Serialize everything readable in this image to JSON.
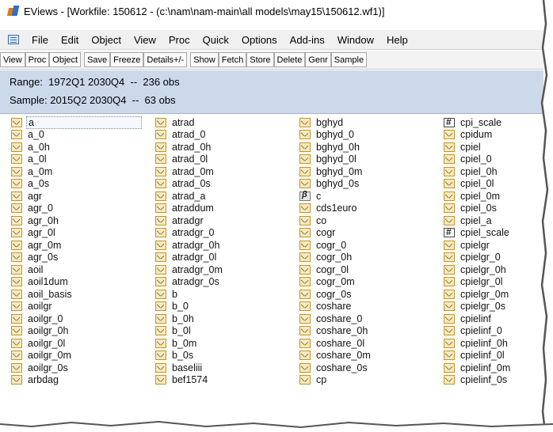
{
  "window": {
    "title": "EViews - [Workfile: 150612 - (c:\\nam\\nam-main\\all models\\may15\\150612.wf1)]"
  },
  "menubar": {
    "items": [
      "File",
      "Edit",
      "Object",
      "View",
      "Proc",
      "Quick",
      "Options",
      "Add-ins",
      "Window",
      "Help"
    ]
  },
  "toolbar": {
    "group1": [
      "View",
      "Proc",
      "Object"
    ],
    "group2": [
      "Save",
      "Freeze",
      "Details+/-"
    ],
    "group3": [
      "Show",
      "Fetch",
      "Store",
      "Delete",
      "Genr",
      "Sample"
    ]
  },
  "info": {
    "range": "Range:  1972Q1 2030Q4  --  236 obs",
    "sample": "Sample: 2015Q2 2030Q4  --  63 obs"
  },
  "objects": {
    "columns": [
      [
        {
          "name": "a",
          "icon": "series-icon",
          "selected": true
        },
        {
          "name": "a_0",
          "icon": "series-icon"
        },
        {
          "name": "a_0h",
          "icon": "series-icon"
        },
        {
          "name": "a_0l",
          "icon": "series-icon"
        },
        {
          "name": "a_0m",
          "icon": "series-icon"
        },
        {
          "name": "a_0s",
          "icon": "series-icon"
        },
        {
          "name": "agr",
          "icon": "series-icon"
        },
        {
          "name": "agr_0",
          "icon": "series-icon"
        },
        {
          "name": "agr_0h",
          "icon": "series-icon"
        },
        {
          "name": "agr_0l",
          "icon": "series-icon"
        },
        {
          "name": "agr_0m",
          "icon": "series-icon"
        },
        {
          "name": "agr_0s",
          "icon": "series-icon"
        },
        {
          "name": "aoil",
          "icon": "series-icon"
        },
        {
          "name": "aoil1dum",
          "icon": "series-icon"
        },
        {
          "name": "aoil_basis",
          "icon": "series-icon"
        },
        {
          "name": "aoilgr",
          "icon": "series-icon"
        },
        {
          "name": "aoilgr_0",
          "icon": "series-icon"
        },
        {
          "name": "aoilgr_0h",
          "icon": "series-icon"
        },
        {
          "name": "aoilgr_0l",
          "icon": "series-icon"
        },
        {
          "name": "aoilgr_0m",
          "icon": "series-icon"
        },
        {
          "name": "aoilgr_0s",
          "icon": "series-icon"
        },
        {
          "name": "arbdag",
          "icon": "series-icon"
        }
      ],
      [
        {
          "name": "atrad",
          "icon": "series-icon"
        },
        {
          "name": "atrad_0",
          "icon": "series-icon"
        },
        {
          "name": "atrad_0h",
          "icon": "series-icon"
        },
        {
          "name": "atrad_0l",
          "icon": "series-icon"
        },
        {
          "name": "atrad_0m",
          "icon": "series-icon"
        },
        {
          "name": "atrad_0s",
          "icon": "series-icon"
        },
        {
          "name": "atrad_a",
          "icon": "series-icon"
        },
        {
          "name": "atraddum",
          "icon": "series-icon"
        },
        {
          "name": "atradgr",
          "icon": "series-icon"
        },
        {
          "name": "atradgr_0",
          "icon": "series-icon"
        },
        {
          "name": "atradgr_0h",
          "icon": "series-icon"
        },
        {
          "name": "atradgr_0l",
          "icon": "series-icon"
        },
        {
          "name": "atradgr_0m",
          "icon": "series-icon"
        },
        {
          "name": "atradgr_0s",
          "icon": "series-icon"
        },
        {
          "name": "b",
          "icon": "series-icon"
        },
        {
          "name": "b_0",
          "icon": "series-icon"
        },
        {
          "name": "b_0h",
          "icon": "series-icon"
        },
        {
          "name": "b_0l",
          "icon": "series-icon"
        },
        {
          "name": "b_0m",
          "icon": "series-icon"
        },
        {
          "name": "b_0s",
          "icon": "series-icon"
        },
        {
          "name": "baseliii",
          "icon": "series-icon"
        },
        {
          "name": "bef1574",
          "icon": "series-icon"
        }
      ],
      [
        {
          "name": "bghyd",
          "icon": "series-icon"
        },
        {
          "name": "bghyd_0",
          "icon": "series-icon"
        },
        {
          "name": "bghyd_0h",
          "icon": "series-icon"
        },
        {
          "name": "bghyd_0l",
          "icon": "series-icon"
        },
        {
          "name": "bghyd_0m",
          "icon": "series-icon"
        },
        {
          "name": "bghyd_0s",
          "icon": "series-icon"
        },
        {
          "name": "c",
          "icon": "coef-icon"
        },
        {
          "name": "cds1euro",
          "icon": "series-icon"
        },
        {
          "name": "co",
          "icon": "series-icon"
        },
        {
          "name": "cogr",
          "icon": "series-icon"
        },
        {
          "name": "cogr_0",
          "icon": "series-icon"
        },
        {
          "name": "cogr_0h",
          "icon": "series-icon"
        },
        {
          "name": "cogr_0l",
          "icon": "series-icon"
        },
        {
          "name": "cogr_0m",
          "icon": "series-icon"
        },
        {
          "name": "cogr_0s",
          "icon": "series-icon"
        },
        {
          "name": "coshare",
          "icon": "series-icon"
        },
        {
          "name": "coshare_0",
          "icon": "series-icon"
        },
        {
          "name": "coshare_0h",
          "icon": "series-icon"
        },
        {
          "name": "coshare_0l",
          "icon": "series-icon"
        },
        {
          "name": "coshare_0m",
          "icon": "series-icon"
        },
        {
          "name": "coshare_0s",
          "icon": "series-icon"
        },
        {
          "name": "cp",
          "icon": "series-icon"
        }
      ],
      [
        {
          "name": "cpi_scale",
          "icon": "scalar-icon"
        },
        {
          "name": "cpidum",
          "icon": "series-icon"
        },
        {
          "name": "cpiel",
          "icon": "series-icon"
        },
        {
          "name": "cpiel_0",
          "icon": "series-icon"
        },
        {
          "name": "cpiel_0h",
          "icon": "series-icon"
        },
        {
          "name": "cpiel_0l",
          "icon": "series-icon"
        },
        {
          "name": "cpiel_0m",
          "icon": "series-icon"
        },
        {
          "name": "cpiel_0s",
          "icon": "series-icon"
        },
        {
          "name": "cpiel_a",
          "icon": "series-icon"
        },
        {
          "name": "cpiel_scale",
          "icon": "scalar-icon"
        },
        {
          "name": "cpielgr",
          "icon": "series-icon"
        },
        {
          "name": "cpielgr_0",
          "icon": "series-icon"
        },
        {
          "name": "cpielgr_0h",
          "icon": "series-icon"
        },
        {
          "name": "cpielgr_0l",
          "icon": "series-icon"
        },
        {
          "name": "cpielgr_0m",
          "icon": "series-icon"
        },
        {
          "name": "cpielgr_0s",
          "icon": "series-icon"
        },
        {
          "name": "cpielinf",
          "icon": "series-icon"
        },
        {
          "name": "cpielinf_0",
          "icon": "series-icon"
        },
        {
          "name": "cpielinf_0h",
          "icon": "series-icon"
        },
        {
          "name": "cpielinf_0l",
          "icon": "series-icon"
        },
        {
          "name": "cpielinf_0m",
          "icon": "series-icon"
        },
        {
          "name": "cpielinf_0s",
          "icon": "series-icon"
        }
      ]
    ]
  }
}
